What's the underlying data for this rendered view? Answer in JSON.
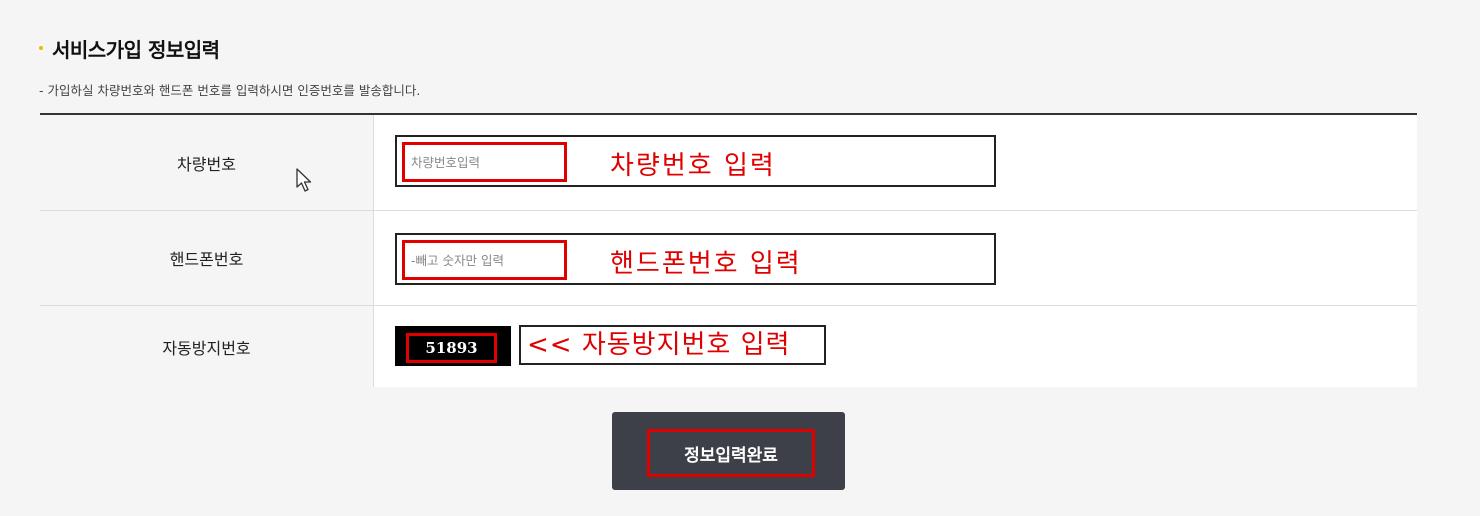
{
  "section": {
    "title": "서비스가입 정보입력",
    "description": "- 가입하실 차량번호와 핸드폰 번호를 입력하시면 인증번호를 발송합니다."
  },
  "form": {
    "rows": [
      {
        "label": "차량번호",
        "placeholder": "차량번호입력",
        "annotation": "차량번호 입력"
      },
      {
        "label": "핸드폰번호",
        "placeholder": "-빼고 숫자만 입력",
        "annotation": "핸드폰번호 입력"
      },
      {
        "label": "자동방지번호",
        "captcha_code": "51893",
        "annotation": "<< 자동방지번호 입력"
      }
    ]
  },
  "submit": {
    "label": "정보입력완료"
  },
  "colors": {
    "accent_bullet": "#f5b800",
    "annotation_red": "#e00000",
    "button_bg": "#3d4048"
  },
  "icons": {
    "cursor": "mouse-pointer-icon"
  }
}
